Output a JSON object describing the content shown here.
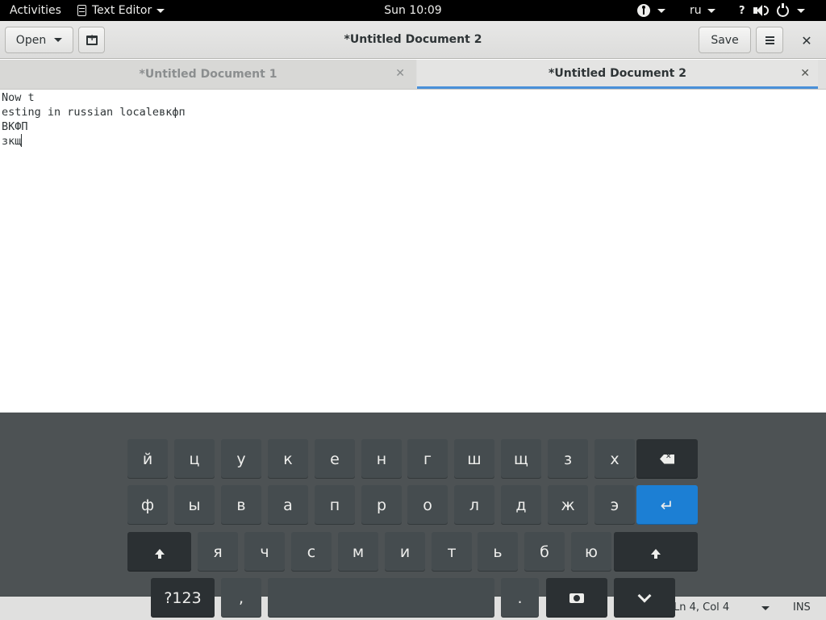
{
  "topbar": {
    "activities": "Activities",
    "app_name": "Text Editor",
    "clock": "Sun 10:09",
    "language": "ru",
    "network": "?"
  },
  "header": {
    "open_label": "Open",
    "title": "*Untitled Document 2",
    "save_label": "Save",
    "close_glyph": "✕"
  },
  "tabs": [
    {
      "label": "*Untitled Document 1",
      "active": false,
      "close_glyph": "✕"
    },
    {
      "label": "*Untitled Document 2",
      "active": true,
      "close_glyph": "✕"
    }
  ],
  "editor": {
    "lines": [
      "Now t",
      "esting in russian localeвкфп",
      "ВКФП",
      "зкщ"
    ]
  },
  "statusbar": {
    "position": "Ln 4, Col 4",
    "mode": "INS"
  },
  "keyboard": {
    "row1": [
      "й",
      "ц",
      "у",
      "к",
      "е",
      "н",
      "г",
      "ш",
      "щ",
      "з",
      "х"
    ],
    "row2": [
      "ф",
      "ы",
      "в",
      "а",
      "п",
      "р",
      "о",
      "л",
      "д",
      "ж",
      "э"
    ],
    "row3": [
      "я",
      "ч",
      "с",
      "м",
      "и",
      "т",
      "ь",
      "б",
      "ю"
    ],
    "numbers_label": "?123",
    "comma": ",",
    "period": ".",
    "icons": {
      "backspace": "backspace-icon",
      "enter": "enter-icon",
      "shift": "shift-icon",
      "emoji": "emoji-icon",
      "hide": "hide-keyboard-icon"
    }
  },
  "colors": {
    "topbar_bg": "#000000",
    "headerbar_bg": "#dcdcdb",
    "active_tab_underline": "#4a90d9",
    "keyboard_bg": "#2e3436",
    "key_bg": "#454c4f",
    "key_dark_bg": "#2b3033",
    "enter_key_bg": "#1c7fd4"
  }
}
